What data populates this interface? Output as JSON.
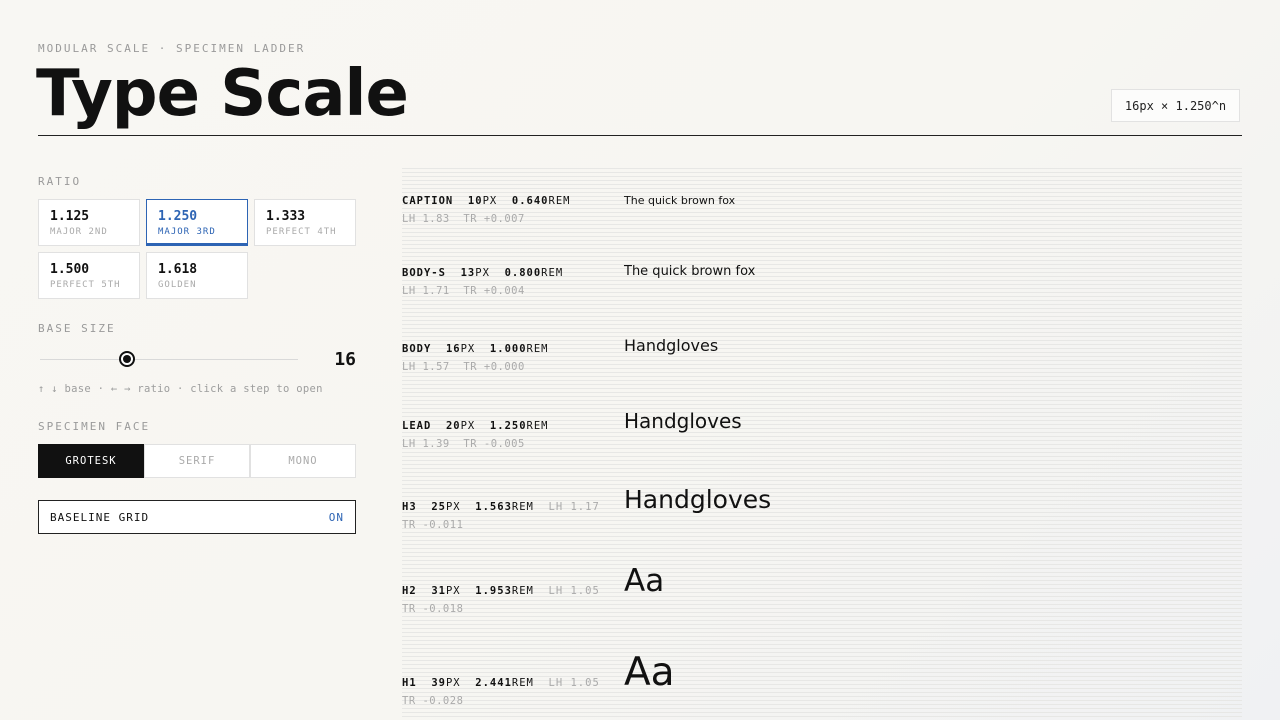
{
  "header": {
    "eyebrow": "MODULAR SCALE · SPECIMEN LADDER",
    "title": "Type Scale",
    "formula": "16px × 1.250^n"
  },
  "ratio": {
    "label": "RATIO",
    "options": [
      {
        "value": "1.125",
        "name": "MAJOR 2ND",
        "selected": false
      },
      {
        "value": "1.250",
        "name": "MAJOR 3RD",
        "selected": true
      },
      {
        "value": "1.333",
        "name": "PERFECT 4TH",
        "selected": false
      },
      {
        "value": "1.500",
        "name": "PERFECT 5TH",
        "selected": false
      },
      {
        "value": "1.618",
        "name": "GOLDEN",
        "selected": false
      }
    ]
  },
  "base": {
    "label": "BASE SIZE",
    "value": "16",
    "hint": "↑ ↓ base · ← → ratio · click a step to open"
  },
  "face": {
    "label": "SPECIMEN FACE",
    "options": [
      "GROTESK",
      "SERIF",
      "MONO"
    ],
    "selected": "GROTESK"
  },
  "baseline": {
    "label": "BASELINE GRID",
    "state": "ON"
  },
  "steps": [
    {
      "name": "CAPTION",
      "px": "10",
      "px_unit": "PX",
      "rem": "0.640",
      "rem_unit": "REM",
      "lh": "LH 1.83",
      "tr": "TR +0.007",
      "specimen": "The quick brown fox"
    },
    {
      "name": "BODY-S",
      "px": "13",
      "px_unit": "PX",
      "rem": "0.800",
      "rem_unit": "REM",
      "lh": "LH 1.71",
      "tr": "TR +0.004",
      "specimen": "The quick brown fox"
    },
    {
      "name": "BODY",
      "px": "16",
      "px_unit": "PX",
      "rem": "1.000",
      "rem_unit": "REM",
      "lh": "LH 1.57",
      "tr": "TR +0.000",
      "specimen": "Handgloves"
    },
    {
      "name": "LEAD",
      "px": "20",
      "px_unit": "PX",
      "rem": "1.250",
      "rem_unit": "REM",
      "lh": "LH 1.39",
      "tr": "TR -0.005",
      "specimen": "Handgloves"
    },
    {
      "name": "H3",
      "px": "25",
      "px_unit": "PX",
      "rem": "1.563",
      "rem_unit": "REM",
      "lh": "LH 1.17",
      "tr": "TR -0.011",
      "specimen": "Handgloves"
    },
    {
      "name": "H2",
      "px": "31",
      "px_unit": "PX",
      "rem": "1.953",
      "rem_unit": "REM",
      "lh": "LH 1.05",
      "tr": "TR -0.018",
      "specimen": "Aa"
    },
    {
      "name": "H1",
      "px": "39",
      "px_unit": "PX",
      "rem": "2.441",
      "rem_unit": "REM",
      "lh": "LH 1.05",
      "tr": "TR -0.028",
      "specimen": "Aa"
    }
  ],
  "colors": {
    "accent": "#2d64b4",
    "ink": "#111111",
    "muted": "#9a9a9a"
  }
}
